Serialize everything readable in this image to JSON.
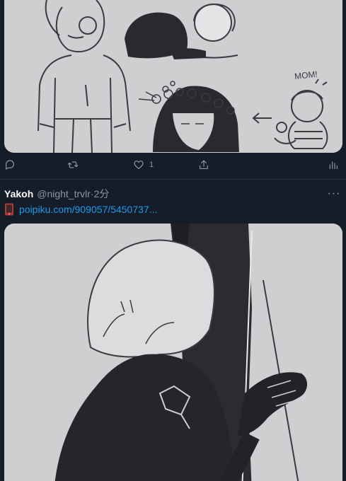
{
  "previous_tweet": {
    "image_description_label": "",
    "actions": {
      "reply_count": "",
      "retweet_count": "",
      "like_count": "1",
      "share_count": ""
    }
  },
  "tweet": {
    "display_name": "Yakoh",
    "handle": "@night_trvlr",
    "separator": "·",
    "time": "2分",
    "more_label": "···",
    "link_text": "poipiku.com/909057/5450737...",
    "link_icon": "mobile-phone-icon"
  },
  "colors": {
    "background": "#151d28",
    "link": "#1d9bf0",
    "muted": "#8b98a5",
    "media_bg": "#cfcfd2"
  },
  "mom_note": "MOM!"
}
